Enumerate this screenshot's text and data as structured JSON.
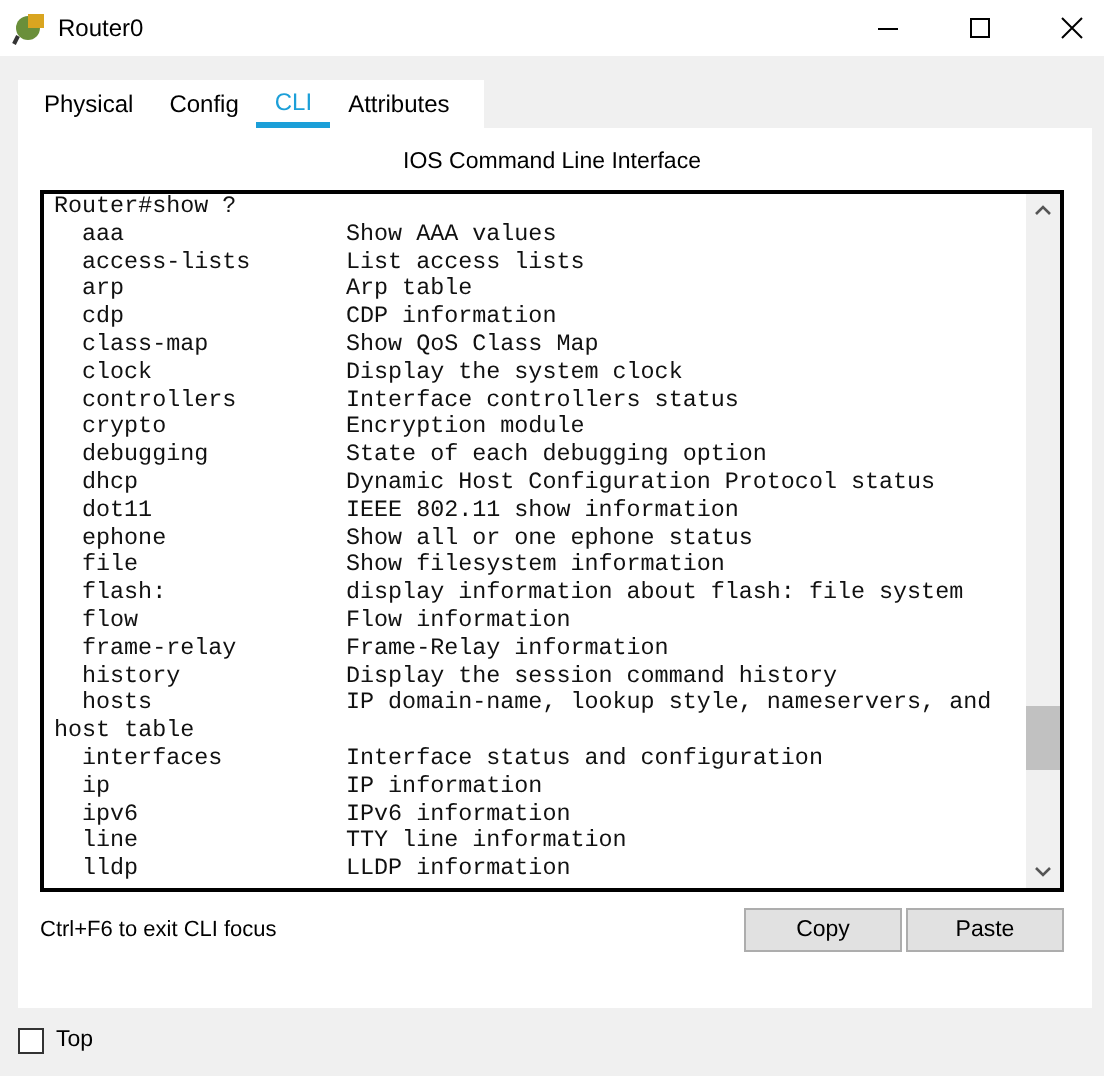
{
  "window": {
    "title": "Router0"
  },
  "tabs": [
    {
      "label": "Physical",
      "selected": false
    },
    {
      "label": "Config",
      "selected": false
    },
    {
      "label": "CLI",
      "selected": true
    },
    {
      "label": "Attributes",
      "selected": false
    }
  ],
  "panel_title": "IOS Command Line Interface",
  "console": [
    {
      "kind": "text",
      "text": "Router#show ?"
    },
    {
      "kind": "entry",
      "command": "aaa",
      "description": "Show AAA values"
    },
    {
      "kind": "entry",
      "command": "access-lists",
      "description": "List access lists"
    },
    {
      "kind": "entry",
      "command": "arp",
      "description": "Arp table"
    },
    {
      "kind": "entry",
      "command": "cdp",
      "description": "CDP information"
    },
    {
      "kind": "entry",
      "command": "class-map",
      "description": "Show QoS Class Map"
    },
    {
      "kind": "entry",
      "command": "clock",
      "description": "Display the system clock"
    },
    {
      "kind": "entry",
      "command": "controllers",
      "description": "Interface controllers status"
    },
    {
      "kind": "entry",
      "command": "crypto",
      "description": "Encryption module"
    },
    {
      "kind": "entry",
      "command": "debugging",
      "description": "State of each debugging option"
    },
    {
      "kind": "entry",
      "command": "dhcp",
      "description": "Dynamic Host Configuration Protocol status"
    },
    {
      "kind": "entry",
      "command": "dot11",
      "description": "IEEE 802.11 show information"
    },
    {
      "kind": "entry",
      "command": "ephone",
      "description": "Show all or one ephone status"
    },
    {
      "kind": "entry",
      "command": "file",
      "description": "Show filesystem information"
    },
    {
      "kind": "entry",
      "command": "flash:",
      "description": "display information about flash: file system"
    },
    {
      "kind": "entry",
      "command": "flow",
      "description": "Flow information"
    },
    {
      "kind": "entry",
      "command": "frame-relay",
      "description": "Frame-Relay information"
    },
    {
      "kind": "entry",
      "command": "history",
      "description": "Display the session command history"
    },
    {
      "kind": "entry",
      "command": "hosts",
      "description": "IP domain-name, lookup style, nameservers, and"
    },
    {
      "kind": "text",
      "text": "host table"
    },
    {
      "kind": "entry",
      "command": "interfaces",
      "description": "Interface status and configuration"
    },
    {
      "kind": "entry",
      "command": "ip",
      "description": "IP information"
    },
    {
      "kind": "entry",
      "command": "ipv6",
      "description": "IPv6 information"
    },
    {
      "kind": "entry",
      "command": "line",
      "description": "TTY line information"
    },
    {
      "kind": "entry",
      "command": "lldp",
      "description": "LLDP information"
    }
  ],
  "hint": "Ctrl+F6 to exit CLI focus",
  "buttons": [
    "Copy",
    "Paste"
  ],
  "top_checkbox": {
    "label": "Top",
    "checked": false
  }
}
